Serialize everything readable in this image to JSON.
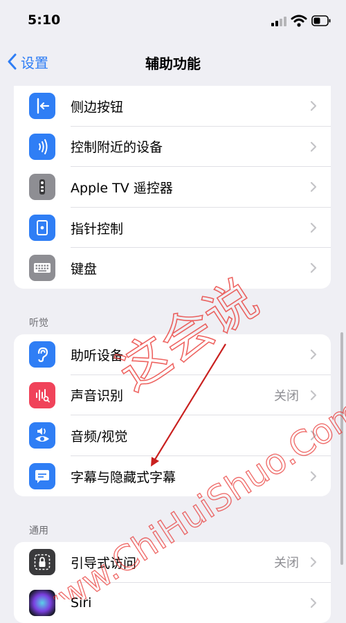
{
  "status": {
    "time": "5:10"
  },
  "nav": {
    "back_label": "设置",
    "title": "辅助功能"
  },
  "colors": {
    "accent": "#2f7ef5",
    "icon_blue": "#2f7ef5",
    "icon_gray": "#8e8e93",
    "icon_red": "#f0435a",
    "icon_dark": "#3a3a3c",
    "watermark": "#e8312e"
  },
  "groups": {
    "interaction": {
      "items": [
        {
          "label": "侧边按钮",
          "icon": "side-button-icon"
        },
        {
          "label": "控制附近的设备",
          "icon": "nearby-devices-icon"
        },
        {
          "label": "Apple TV 遥控器",
          "icon": "apple-tv-remote-icon"
        },
        {
          "label": "指针控制",
          "icon": "pointer-control-icon"
        },
        {
          "label": "键盘",
          "icon": "keyboard-icon"
        }
      ]
    },
    "hearing": {
      "header": "听觉",
      "items": [
        {
          "label": "助听设备",
          "icon": "ear-icon"
        },
        {
          "label": "声音识别",
          "icon": "sound-recognition-icon",
          "value": "关闭"
        },
        {
          "label": "音频/视觉",
          "icon": "audio-visual-icon"
        },
        {
          "label": "字幕与隐藏式字幕",
          "icon": "subtitles-icon"
        }
      ]
    },
    "general": {
      "header": "通用",
      "items": [
        {
          "label": "引导式访问",
          "icon": "guided-access-icon",
          "value": "关闭"
        },
        {
          "label": "Siri",
          "icon": "siri-icon"
        }
      ]
    }
  },
  "watermark": {
    "line1": "这会说",
    "line2": "www.ChiHuiShuo.Com"
  }
}
